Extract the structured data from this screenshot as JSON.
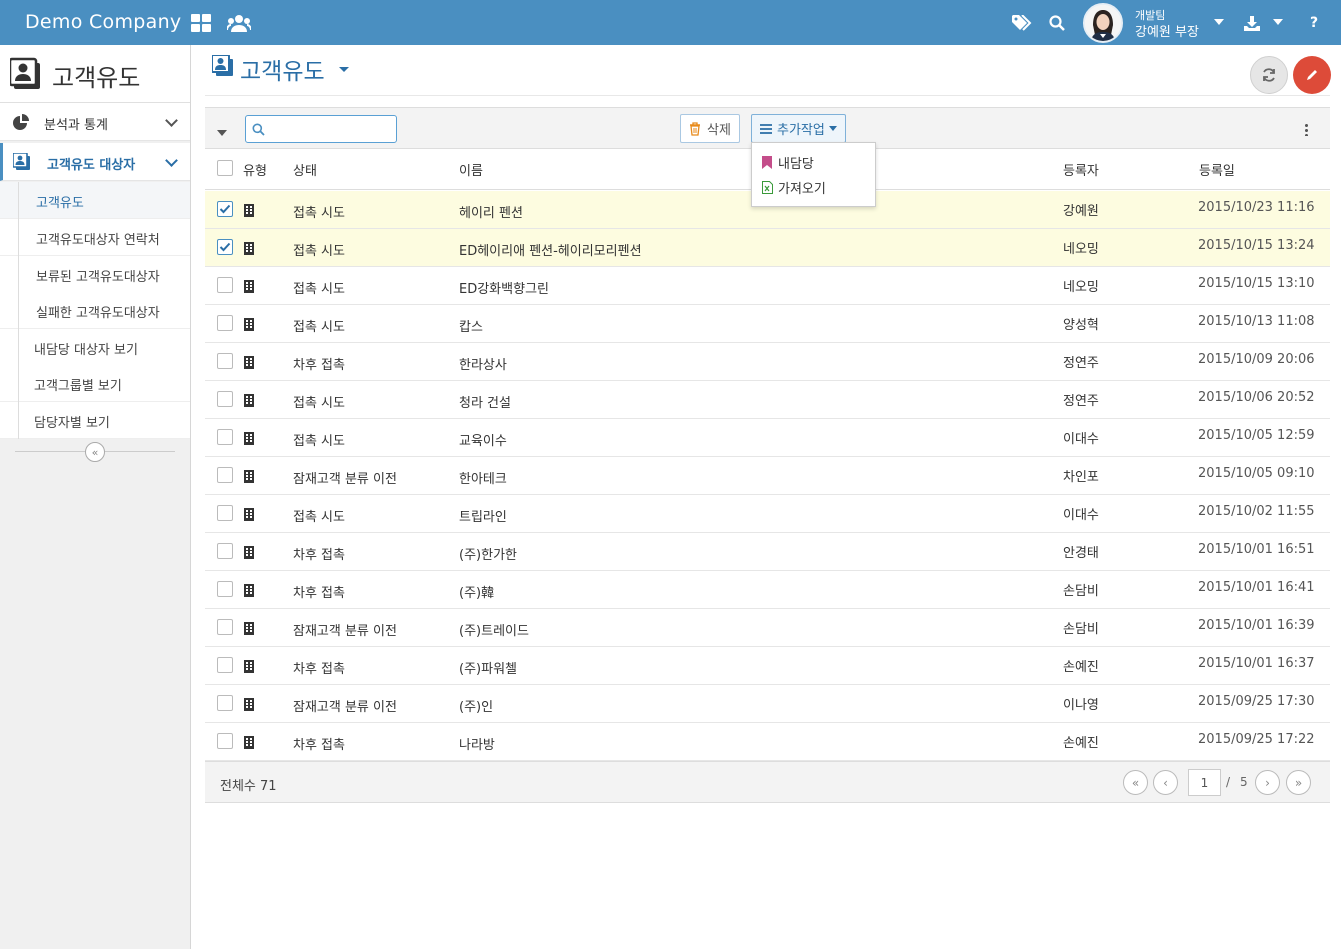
{
  "app": {
    "brand": "Demo Company"
  },
  "user": {
    "team": "개발팀",
    "name": "강예원 부장"
  },
  "sidebar": {
    "title": "고객유도",
    "groups": [
      {
        "label": "분석과 통계"
      },
      {
        "label": "고객유도 대상자"
      }
    ],
    "items": [
      {
        "label": "고객유도"
      },
      {
        "label": "고객유도대상자 연락처"
      },
      {
        "label": "보류된 고객유도대상자"
      },
      {
        "label": "실패한 고객유도대상자"
      },
      {
        "label": "내담당 대상자 보기"
      },
      {
        "label": "고객그룹별 보기"
      },
      {
        "label": "담당자별 보기"
      }
    ],
    "collapse_glyph": "«"
  },
  "main": {
    "title": "고객유도"
  },
  "toolbar": {
    "search": {
      "value": "",
      "placeholder": ""
    },
    "delete_label": "삭제",
    "more_label": "추가작업",
    "dropdown": [
      {
        "label": "내담당"
      },
      {
        "label": "가져오기"
      }
    ]
  },
  "table": {
    "columns": {
      "type": "유형",
      "status": "상태",
      "name": "이름",
      "registrant": "등록자",
      "date": "등록일"
    },
    "rows": [
      {
        "checked": true,
        "status": "접촉 시도",
        "name": "헤이리 펜션",
        "registrant": "강예원",
        "date": "2015/10/23 11:16"
      },
      {
        "checked": true,
        "status": "접촉 시도",
        "name": "ED헤이리애 펜션-헤이리모리펜션",
        "registrant": "네오밍",
        "date": "2015/10/15 13:24"
      },
      {
        "checked": false,
        "status": "접촉 시도",
        "name": "ED강화백향그린",
        "registrant": "네오밍",
        "date": "2015/10/15 13:10"
      },
      {
        "checked": false,
        "status": "접촉 시도",
        "name": "캅스",
        "registrant": "양성혁",
        "date": "2015/10/13 11:08"
      },
      {
        "checked": false,
        "status": "차후 접촉",
        "name": "한라상사",
        "registrant": "정연주",
        "date": "2015/10/09 20:06"
      },
      {
        "checked": false,
        "status": "접촉 시도",
        "name": "청라 건설",
        "registrant": "정연주",
        "date": "2015/10/06 20:52"
      },
      {
        "checked": false,
        "status": "접촉 시도",
        "name": "교육이수",
        "registrant": "이대수",
        "date": "2015/10/05 12:59"
      },
      {
        "checked": false,
        "status": "잠재고객 분류 이전",
        "name": "한아테크",
        "registrant": "차인포",
        "date": "2015/10/05 09:10"
      },
      {
        "checked": false,
        "status": "접촉 시도",
        "name": "트립라인",
        "registrant": "이대수",
        "date": "2015/10/02 11:55"
      },
      {
        "checked": false,
        "status": "차후 접촉",
        "name": "(주)한가한",
        "registrant": "안경태",
        "date": "2015/10/01 16:51"
      },
      {
        "checked": false,
        "status": "차후 접촉",
        "name": "(주)韓",
        "registrant": "손담비",
        "date": "2015/10/01 16:41"
      },
      {
        "checked": false,
        "status": "잠재고객 분류 이전",
        "name": "(주)트레이드",
        "registrant": "손담비",
        "date": "2015/10/01 16:39"
      },
      {
        "checked": false,
        "status": "차후 접촉",
        "name": "(주)파워첼",
        "registrant": "손예진",
        "date": "2015/10/01 16:37"
      },
      {
        "checked": false,
        "status": "잠재고객 분류 이전",
        "name": "(주)인",
        "registrant": "이나영",
        "date": "2015/09/25 17:30"
      },
      {
        "checked": false,
        "status": "차후 접촉",
        "name": "나라방",
        "registrant": "손예진",
        "date": "2015/09/25 17:22"
      }
    ]
  },
  "footer": {
    "total": "전체수 71",
    "page": {
      "current": "1",
      "separator": "/",
      "total": "5"
    }
  },
  "colors": {
    "topbar": "#4a8fc1",
    "accent": "#2a6ea6",
    "edit": "#dd4b39",
    "selected_row": "#fdfce0"
  },
  "icons": [
    "apps-grid-icon",
    "users-icon",
    "tags-icon",
    "search-icon",
    "download-icon",
    "help-icon",
    "refresh-icon",
    "pencil-icon",
    "trash-icon",
    "list-icon",
    "bookmark-icon",
    "excel-file-icon",
    "pie-chart-icon",
    "contacts-icon",
    "building-icon",
    "kebab-icon"
  ]
}
